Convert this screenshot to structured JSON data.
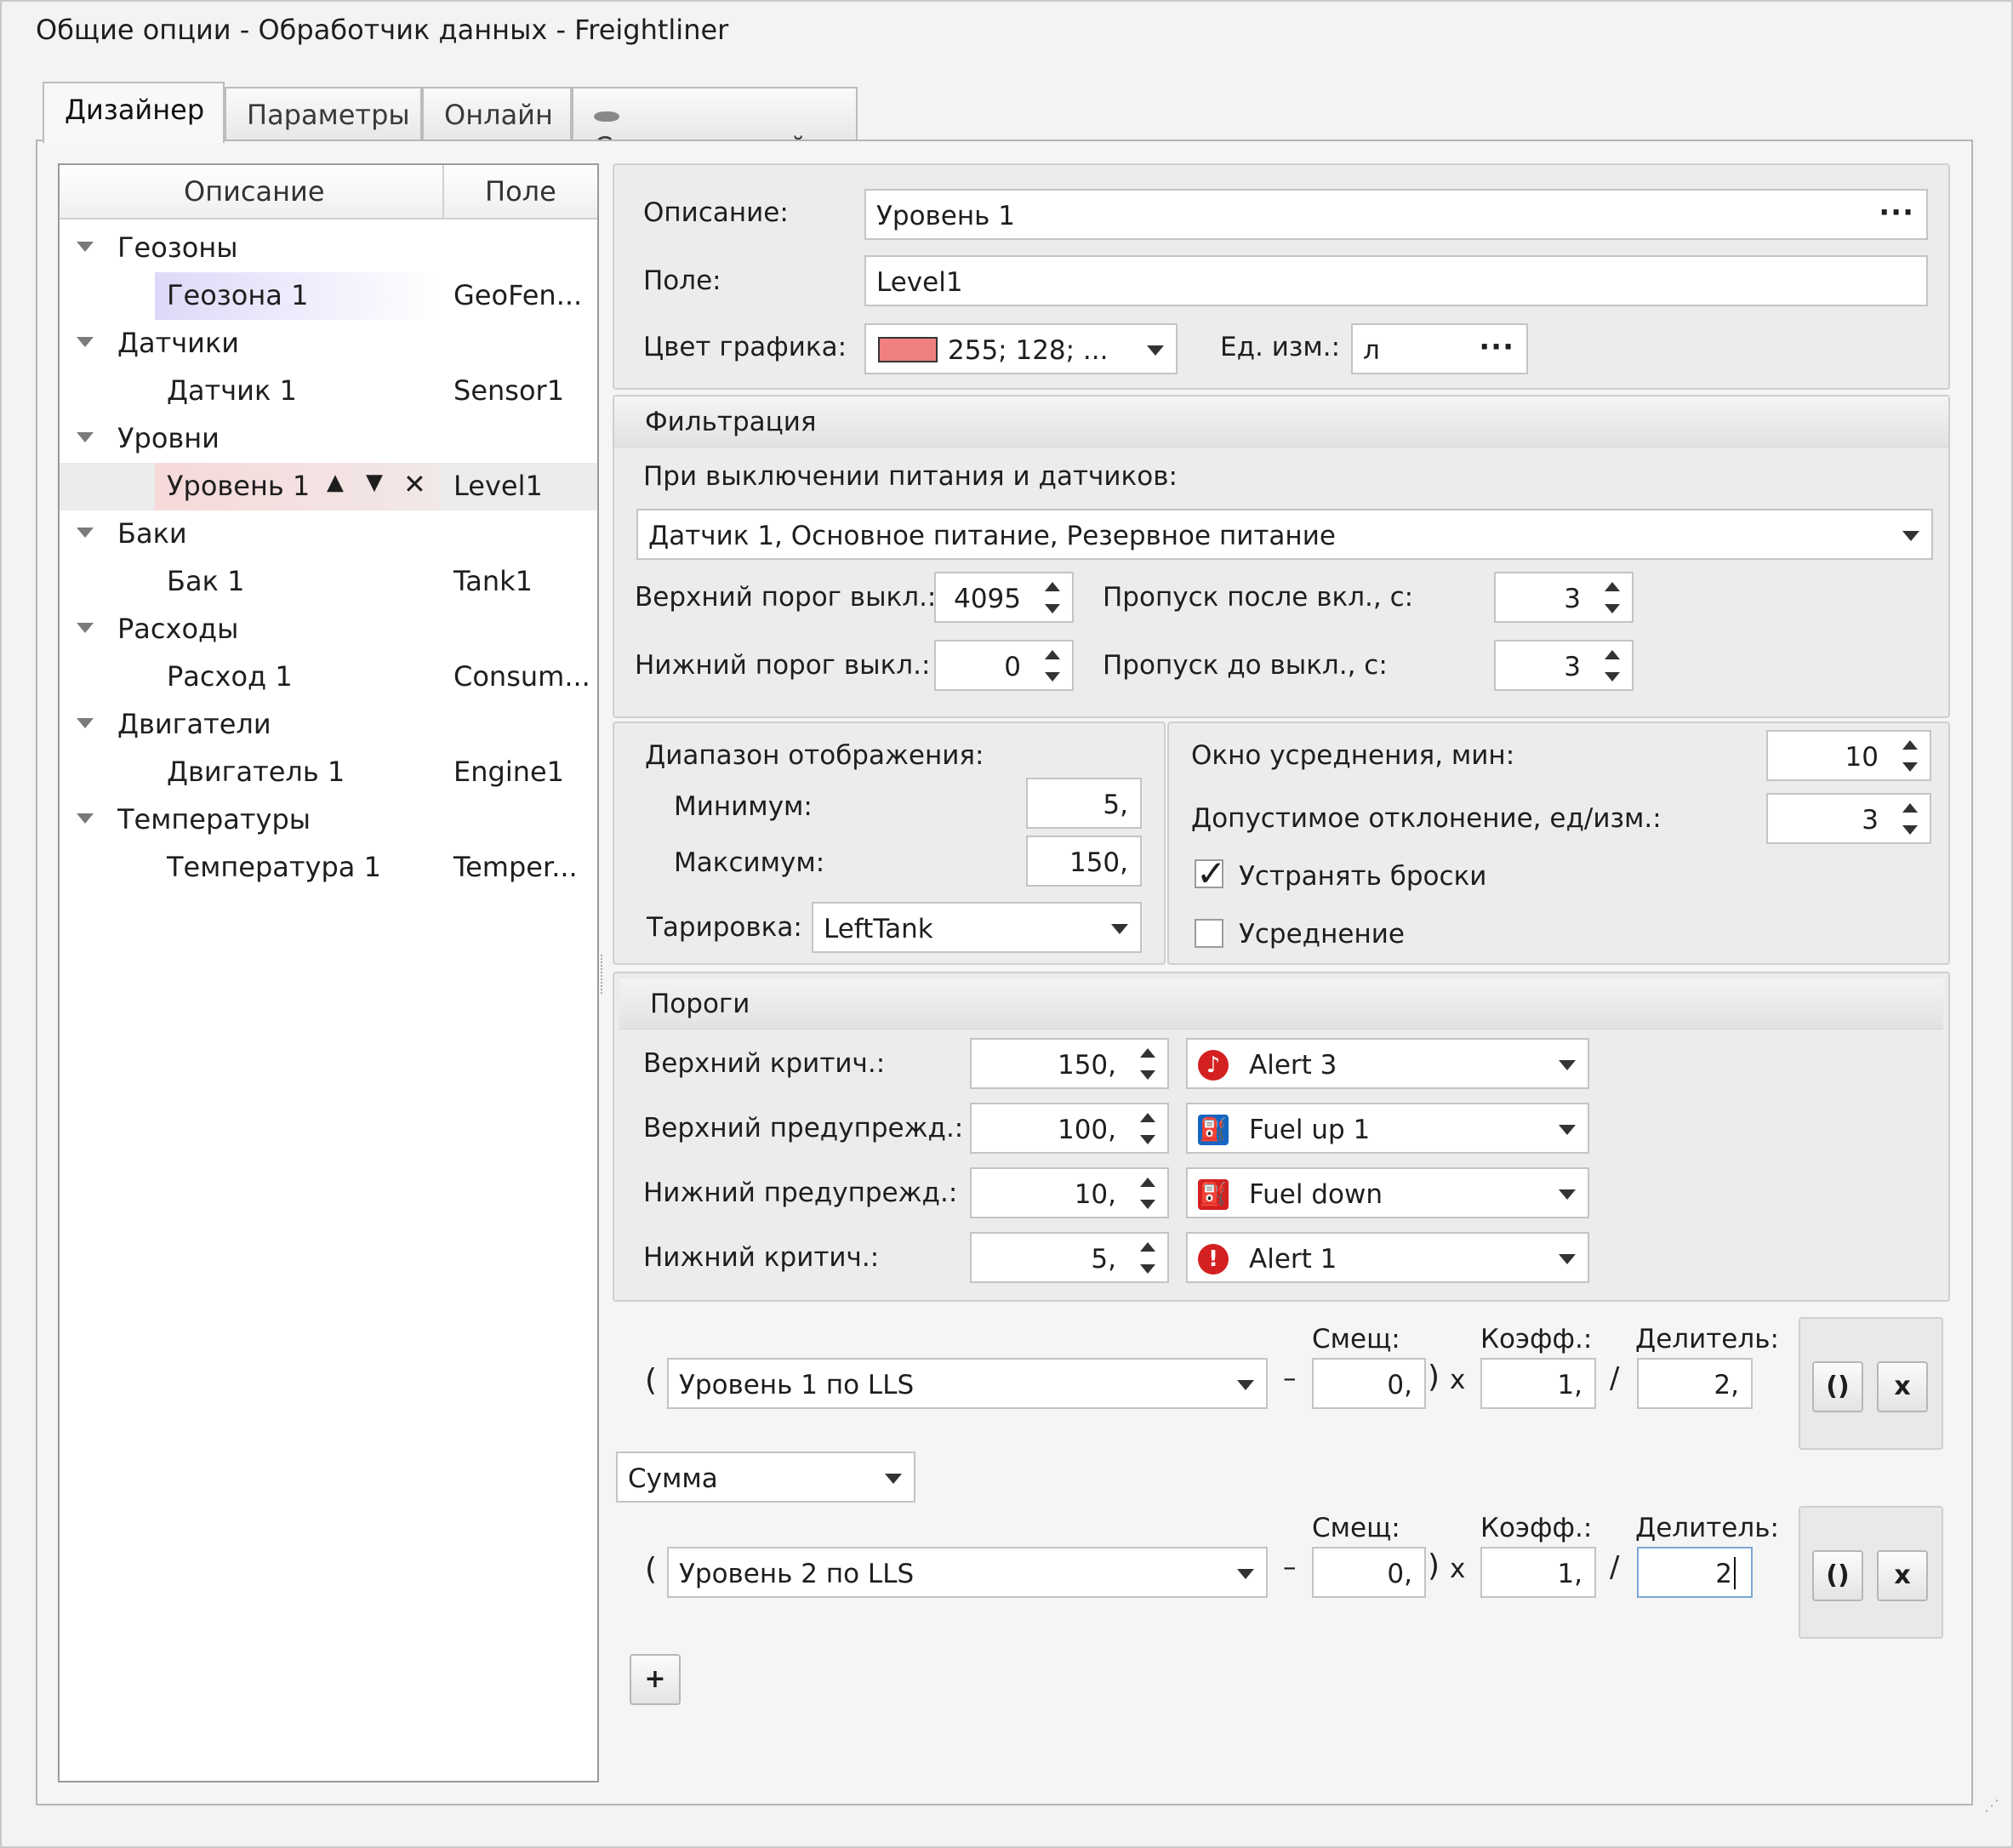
{
  "window": {
    "title": "Общие опции - Обработчик данных - Freightliner"
  },
  "tabs": [
    {
      "label": "Дизайнер"
    },
    {
      "label": "Параметры"
    },
    {
      "label": "Онлайн"
    },
    {
      "label": "Стационарный"
    }
  ],
  "tree": {
    "headers": {
      "description": "Описание",
      "field": "Поле"
    },
    "rows": [
      {
        "label": "Геозоны",
        "field": ""
      },
      {
        "label": "Геозона 1",
        "field": "GeoFen..."
      },
      {
        "label": "Датчики",
        "field": ""
      },
      {
        "label": "Датчик 1",
        "field": "Sensor1"
      },
      {
        "label": "Уровни",
        "field": ""
      },
      {
        "label": "Уровень 1",
        "field": "Level1"
      },
      {
        "label": "Баки",
        "field": ""
      },
      {
        "label": "Бак 1",
        "field": "Tank1"
      },
      {
        "label": "Расходы",
        "field": ""
      },
      {
        "label": "Расход 1",
        "field": "Consum..."
      },
      {
        "label": "Двигатели",
        "field": ""
      },
      {
        "label": "Двигатель 1",
        "field": "Engine1"
      },
      {
        "label": "Температуры",
        "field": ""
      },
      {
        "label": "Температура 1",
        "field": "Temper..."
      }
    ],
    "row_actions": {
      "up": "▲",
      "down": "▼",
      "delete": "✕"
    }
  },
  "props": {
    "description_label": "Описание:",
    "description_value": "Уровень 1",
    "field_label": "Поле:",
    "field_value": "Level1",
    "color_label": "Цвет графика:",
    "color_value": "255; 128; ...",
    "color_hex": "#f08080",
    "unit_label": "Ед. изм.:",
    "unit_value": "л"
  },
  "filter": {
    "title": "Фильтрация",
    "power_label": "При выключении питания и датчиков:",
    "power_value": "Датчик 1, Основное питание, Резервное питание",
    "upper_off_label": "Верхний порог выкл.:",
    "upper_off_value": "4095",
    "lower_off_label": "Нижний порог выкл.:",
    "lower_off_value": "0",
    "skip_after_label": "Пропуск после вкл., с:",
    "skip_after_value": "3",
    "skip_before_label": "Пропуск до выкл., с:",
    "skip_before_value": "3"
  },
  "range": {
    "title": "Диапазон отображения:",
    "min_label": "Минимум:",
    "min_value": "5,",
    "max_label": "Максимум:",
    "max_value": "150,",
    "calib_label": "Тарировка:",
    "calib_value": "LeftTank"
  },
  "avg": {
    "window_label": "Окно усреднения, мин:",
    "window_value": "10",
    "dev_label": "Допустимое отклонение, ед/изм.:",
    "dev_value": "3",
    "spikes_label": "Устранять броски",
    "spikes_checked": true,
    "avg_label": "Усреднение",
    "avg_checked": false
  },
  "thresholds": {
    "title": "Пороги",
    "rows": [
      {
        "label": "Верхний критич.:",
        "value": "150,",
        "event": "Alert 3",
        "icon": "alarm-bell-icon",
        "color": "#d42020"
      },
      {
        "label": "Верхний предупрежд.:",
        "value": "100,",
        "event": "Fuel up 1",
        "icon": "fuel-up-icon",
        "color": "#1565c0"
      },
      {
        "label": "Нижний предупрежд.:",
        "value": "10,",
        "event": "Fuel down",
        "icon": "fuel-down-icon",
        "color": "#d42020"
      },
      {
        "label": "Нижний критич.:",
        "value": "5,",
        "event": "Alert 1",
        "icon": "exclamation-icon",
        "color": "#d42020"
      }
    ]
  },
  "formula": {
    "offset_label": "Смещ:",
    "coef_label": "Коэфф.:",
    "div_label": "Делитель:",
    "open_paren": "(",
    "close_paren": ")",
    "minus": "–",
    "times": "x",
    "slash": "/",
    "terms": [
      {
        "source": "Уровень 1 по LLS",
        "offset": "0,",
        "coef": "1,",
        "divisor": "2,"
      },
      {
        "source": "Уровень 2 по LLS",
        "offset": "0,",
        "coef": "1,",
        "divisor": "2"
      }
    ],
    "operation": "Сумма",
    "group_btn": "()",
    "remove_btn": "x",
    "add_btn": "+"
  }
}
